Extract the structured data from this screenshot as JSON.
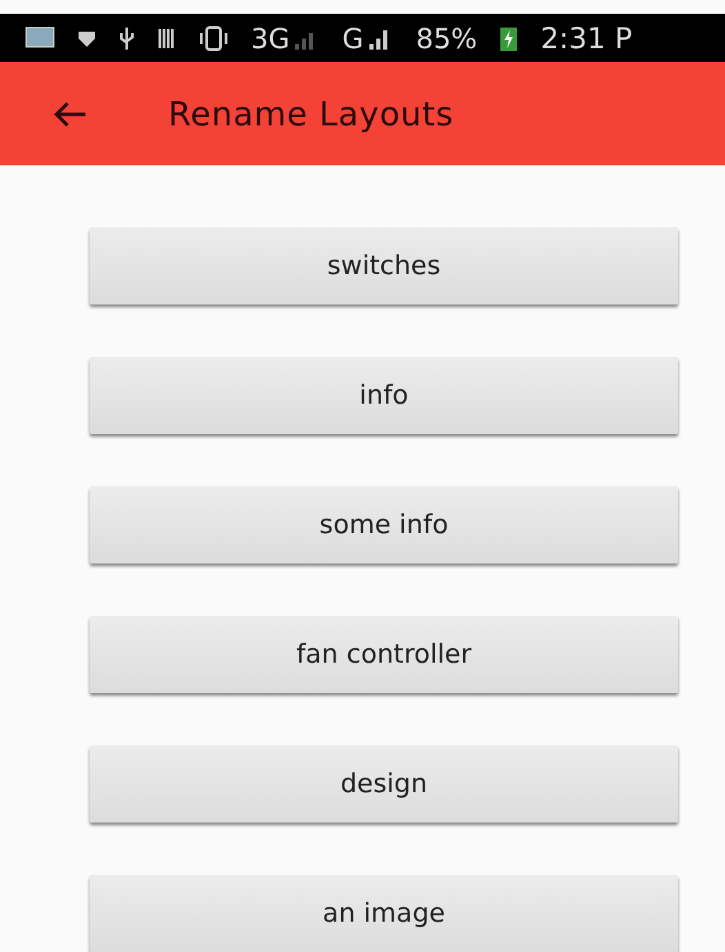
{
  "status_bar": {
    "network_1": "3G",
    "network_2": "G",
    "battery": "85%",
    "time": "2:31 P"
  },
  "app_bar": {
    "title": "Rename Layouts"
  },
  "layouts": [
    {
      "label": "switches"
    },
    {
      "label": "info"
    },
    {
      "label": "some info"
    },
    {
      "label": "fan controller"
    },
    {
      "label": "design"
    },
    {
      "label": "an image"
    }
  ]
}
